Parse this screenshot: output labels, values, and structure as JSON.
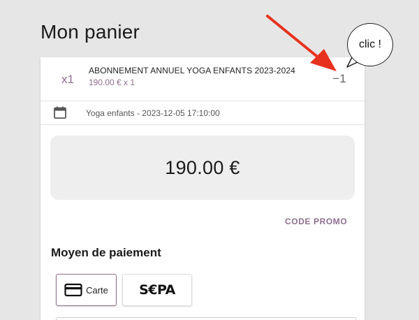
{
  "page": {
    "title": "Mon panier"
  },
  "cart": {
    "item": {
      "quantity": "x1",
      "name": "ABONNEMENT ANNUEL YOGA ENFANTS 2023-2024",
      "price_line": "190.00 € x 1",
      "decrement_label": "−1"
    },
    "session": {
      "icon": "calendar-icon",
      "label": "Yoga enfants - 2023-12-05 17:10:00"
    },
    "total": "190.00 €",
    "promo_label": "CODE PROMO"
  },
  "payment": {
    "title": "Moyen de paiement",
    "methods": [
      {
        "label": "Carte",
        "icon": "credit-card-icon",
        "selected": true
      },
      {
        "label": "S€PA",
        "icon": "sepa-logo",
        "selected": false
      }
    ]
  },
  "annotation": {
    "bubble_text": "clic !",
    "arrow_color": "#e8321f"
  },
  "colors": {
    "accent": "#8e6f8e",
    "background": "#e6e6e6",
    "total_box": "#eeeeee"
  }
}
